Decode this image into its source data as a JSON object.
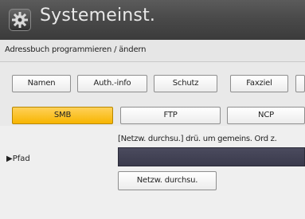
{
  "header": {
    "title": "Systemeinst.",
    "icon": "gear-icon"
  },
  "breadcrumb": "Adressbuch programmieren / ändern",
  "tabs": [
    {
      "label": "Namen"
    },
    {
      "label": "Auth.-info"
    },
    {
      "label": "Schutz"
    },
    {
      "label": "Faxziel"
    },
    {
      "label": "E"
    }
  ],
  "protocols": {
    "selected": "SMB",
    "items": [
      {
        "label": "SMB"
      },
      {
        "label": "FTP"
      },
      {
        "label": "NCP"
      }
    ],
    "selected_color": "#f7b500"
  },
  "path": {
    "label": "▶Pfad",
    "hint": "[Netzw. durchsu.] drü. um gemeins. Ord z.",
    "value": "",
    "browse_label": "Netzw. durchsu."
  }
}
